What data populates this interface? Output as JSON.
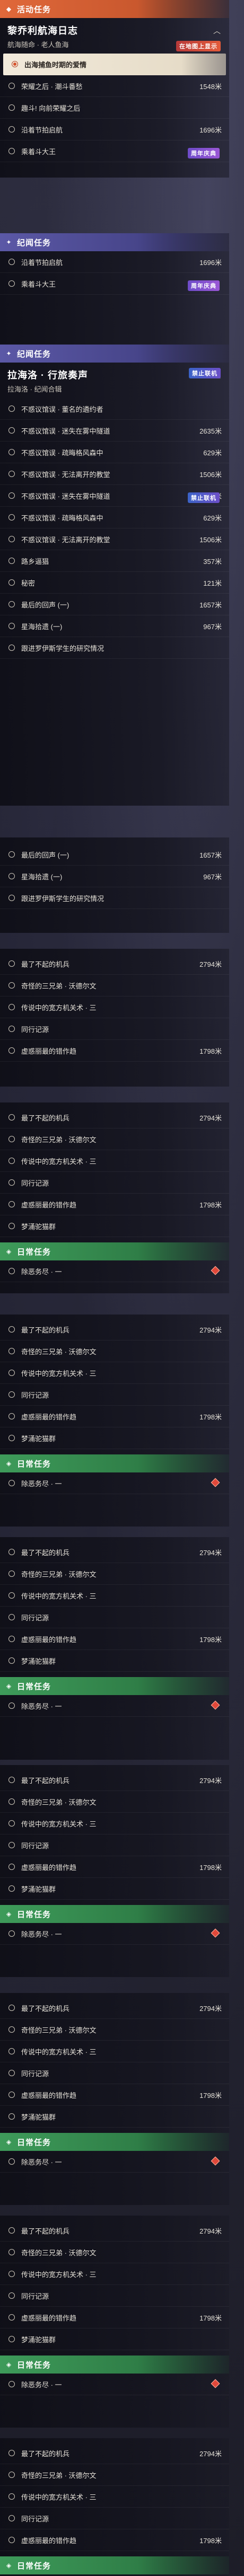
{
  "labels": {
    "event": "活动任务",
    "lore": "纪闻任务",
    "daily": "日常任务",
    "forbidden": "禁止联机",
    "weekly": "周年庆典",
    "track": "在地图上显示"
  },
  "quest1": {
    "title": "黎乔利航海日志",
    "subtitle": "航海随命 · 老人鱼海",
    "rows": [
      {
        "name": "出海捕鱼时期的爱情",
        "dist": ""
      },
      {
        "name": "荣耀之后 · 潮斗番愁",
        "dist": "1548米"
      },
      {
        "name": "趣斗! 向前荣耀之后",
        "dist": ""
      },
      {
        "name": "沿着节拍启航",
        "dist": "1696米"
      },
      {
        "name": "乘着斗大王",
        "dist": ""
      }
    ]
  },
  "quest1b": {
    "rows": [
      {
        "name": "沿着节拍启航",
        "dist": "1696米"
      },
      {
        "name": "乘着斗大王",
        "dist": ""
      }
    ]
  },
  "quest2": {
    "title": "拉海洛 · 行旅奏声",
    "subtitle": "拉海洛 · 纪闻合辑",
    "rows": [
      {
        "name": "不惑议馆误 · 董名的遴约者",
        "dist": ""
      },
      {
        "name": "不惑议馆误 · 迷失在雾中隧道",
        "dist": "2635米"
      },
      {
        "name": "不惑议馆误 · 疏晦格风森中",
        "dist": "629米"
      },
      {
        "name": "不惑议馆误 · 无法离开的教堂",
        "dist": "1506米"
      },
      {
        "name": "不惑议馆误 · 迷失在雾中隧道",
        "dist": "2635米"
      },
      {
        "name": "不惑议馆误 · 疏晦格风森中",
        "dist": "629米"
      },
      {
        "name": "不惑议馆误 · 无法离开的教堂",
        "dist": "1506米"
      },
      {
        "name": "路乡逼猖",
        "dist": "357米"
      },
      {
        "name": "秘密",
        "dist": "121米"
      },
      {
        "name": "最后的回声 (一)",
        "dist": "1657米"
      },
      {
        "name": "星海拾遗 (一)",
        "dist": "967米"
      },
      {
        "name": "跟进罗伊斯学生的研究情况",
        "dist": ""
      }
    ]
  },
  "quest2b": {
    "rows": [
      {
        "name": "最后的回声 (一)",
        "dist": "1657米"
      },
      {
        "name": "星海拾遗 (一)",
        "dist": "967米"
      },
      {
        "name": "跟进罗伊斯学生的研究情况",
        "dist": ""
      }
    ]
  },
  "lore_rows": [
    {
      "name": "最了不起的机兵",
      "dist": "2794米"
    },
    {
      "name": "奇怪的三兄弟 · 沃德尔文",
      "dist": ""
    },
    {
      "name": "传说中的宽方机关术 · 三",
      "dist": ""
    },
    {
      "name": "同行记源",
      "dist": ""
    },
    {
      "name": "虚惑丽最的错作趋",
      "dist": "1798米"
    }
  ],
  "lore_rows2": [
    {
      "name": "最了不起的机兵",
      "dist": "2794米"
    },
    {
      "name": "奇怪的三兄弟 · 沃德尔文",
      "dist": ""
    },
    {
      "name": "传说中的宽方机关术 · 三",
      "dist": ""
    },
    {
      "name": "同行记源",
      "dist": ""
    },
    {
      "name": "虚惑丽最的错作趋",
      "dist": "1798米"
    },
    {
      "name": "梦涌驼猫群",
      "dist": ""
    }
  ],
  "daily_row": {
    "name": "除恶务尽 · 一",
    "dist": ""
  }
}
